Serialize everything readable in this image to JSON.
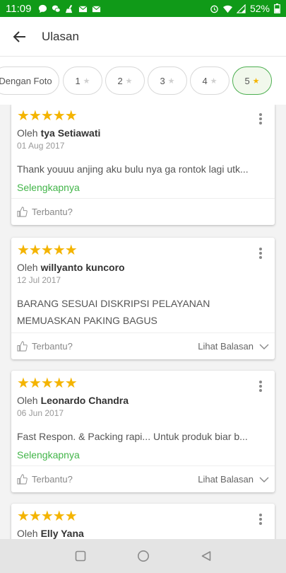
{
  "status_bar": {
    "time": "11:09",
    "battery": "52%",
    "icons_left": [
      "chat-icon",
      "wechat-icon",
      "broom-icon",
      "mail-icon",
      "mail-icon"
    ],
    "icons_right": [
      "alarm-icon",
      "wifi-icon",
      "signal-icon",
      "battery-icon"
    ]
  },
  "app_bar": {
    "title": "Ulasan"
  },
  "filters": [
    {
      "label": "Dengan Foto",
      "star": false,
      "active": false
    },
    {
      "label": "1",
      "star": true,
      "active": false
    },
    {
      "label": "2",
      "star": true,
      "active": false
    },
    {
      "label": "3",
      "star": true,
      "active": false
    },
    {
      "label": "4",
      "star": true,
      "active": false
    },
    {
      "label": "5",
      "star": true,
      "active": true
    }
  ],
  "reviews": [
    {
      "stars": "★★★★★",
      "by": "Oleh",
      "name": "tya Setiawati",
      "date": "01 Aug 2017",
      "text": "Thank youuu anjing aku bulu nya ga rontok lagi utk...",
      "more": "Selengkapnya",
      "helpful": "Terbantu?",
      "replies": ""
    },
    {
      "stars": "★★★★★",
      "by": "Oleh",
      "name": "willyanto kuncoro",
      "date": "12 Jul 2017",
      "text": "BARANG SESUAI DISKRIPSI PELAYANAN MEMUASKAN PAKING BAGUS",
      "more": "",
      "helpful": "Terbantu?",
      "replies": "Lihat Balasan"
    },
    {
      "stars": "★★★★★",
      "by": "Oleh",
      "name": "Leonardo Chandra",
      "date": "06 Jun 2017",
      "text": "Fast Respon. & Packing rapi... Untuk produk biar b...",
      "more": "Selengkapnya",
      "helpful": "Terbantu?",
      "replies": "Lihat Balasan"
    },
    {
      "stars": "★★★★★",
      "by": "Oleh",
      "name": "Elly Yana",
      "date": "",
      "text": "",
      "more": "",
      "helpful": "",
      "replies": ""
    }
  ],
  "colors": {
    "status_bar": "#109a18",
    "star": "#f4b400",
    "link": "#42b549",
    "active_chip_border": "#4caf50"
  }
}
